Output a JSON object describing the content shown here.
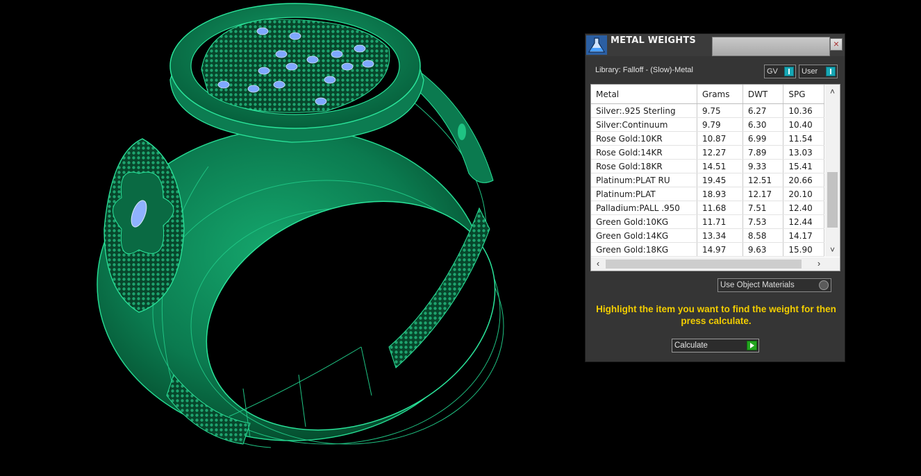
{
  "window": {
    "title": "METAL WEIGHTS",
    "close_label": "×",
    "icon": "flask-icon"
  },
  "library": "Library: Falloff - (Slow)-Metal",
  "toggles": {
    "gv": "GV",
    "user": "User"
  },
  "table": {
    "headers": [
      "Metal",
      "Grams",
      "DWT",
      "SPG"
    ],
    "rows": [
      [
        "Silver:.925 Sterling",
        "9.75",
        "6.27",
        "10.36"
      ],
      [
        "Silver:Continuum",
        "9.79",
        "6.30",
        "10.40"
      ],
      [
        "Rose Gold:10KR",
        "10.87",
        "6.99",
        "11.54"
      ],
      [
        "Rose Gold:14KR",
        "12.27",
        "7.89",
        "13.03"
      ],
      [
        "Rose Gold:18KR",
        "14.51",
        "9.33",
        "15.41"
      ],
      [
        "Platinum:PLAT RU",
        "19.45",
        "12.51",
        "20.66"
      ],
      [
        "Platinum:PLAT",
        "18.93",
        "12.17",
        "20.10"
      ],
      [
        "Palladium:PALL .950",
        "11.68",
        "7.51",
        "12.40"
      ],
      [
        "Green Gold:10KG",
        "11.71",
        "7.53",
        "12.44"
      ],
      [
        "Green Gold:14KG",
        "13.34",
        "8.58",
        "14.17"
      ],
      [
        "Green Gold:18KG",
        "14.97",
        "9.63",
        "15.90"
      ]
    ],
    "scroll_up": "˄",
    "scroll_down": "˅",
    "scroll_left": "‹",
    "scroll_right": "›"
  },
  "use_object_materials": "Use Object Materials",
  "hint": "Highlight the item you want to find the weight for then press calculate.",
  "calculate_label": "Calculate",
  "colors": {
    "ring_fill": "#0d7a52",
    "ring_line": "#22d98e",
    "stone": "#7fa8ff",
    "hint": "#f2cd00",
    "accent": "#17a7b5"
  }
}
